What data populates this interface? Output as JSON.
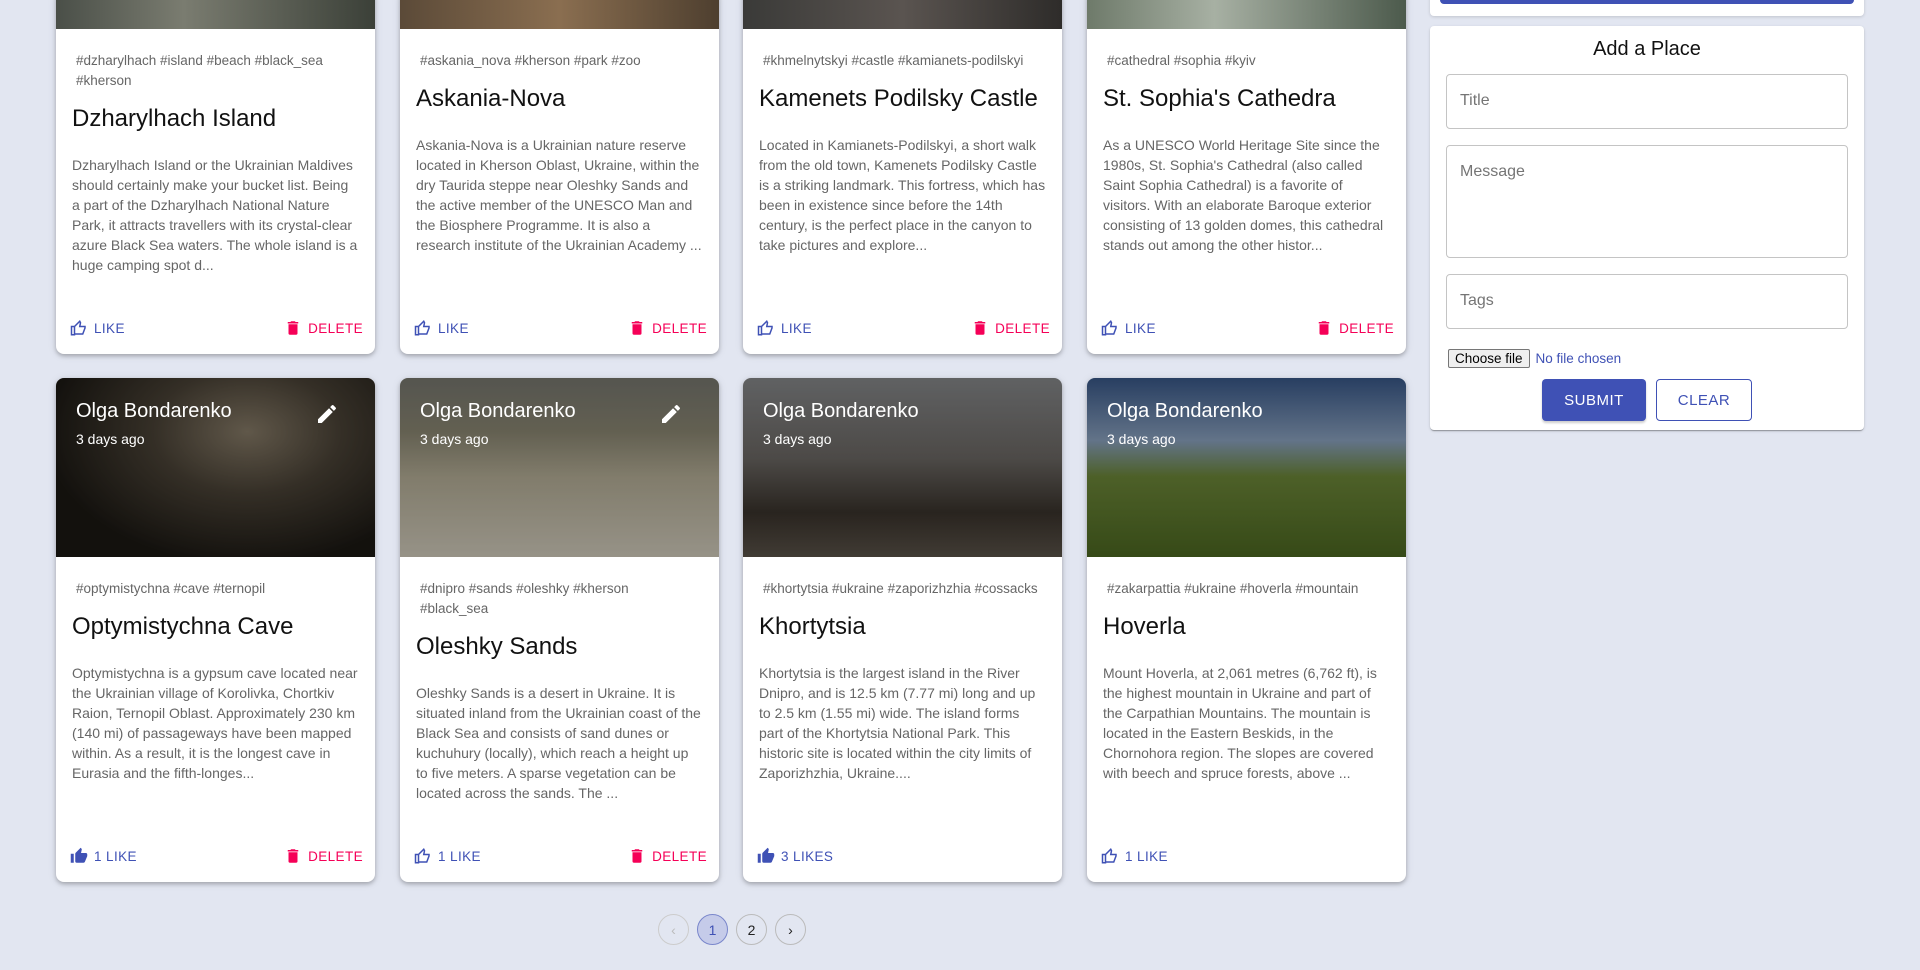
{
  "posts_row1": [
    {
      "tags": "#dzharylhach #island #beach #black_sea #kherson",
      "title": "Dzharylhach Island",
      "message": "Dzharylhach Island or the Ukrainian Maldives should certainly make your bucket list. Being a part of the Dzharylhach National Nature Park, it attracts travellers with its crystal-clear azure Black Sea waters. The whole island is a huge camping spot d...",
      "like_label": "LIKE",
      "delete_label": "DELETE"
    },
    {
      "tags": "#askania_nova #kherson #park #zoo",
      "title": "Askania-Nova",
      "message": "Askania-Nova is a Ukrainian nature reserve located in Kherson Oblast, Ukraine, within the dry Taurida steppe near Oleshky Sands and the active member of the UNESCO Man and the Biosphere Programme. It is also a research institute of the Ukrainian Academy ...",
      "like_label": "LIKE",
      "delete_label": "DELETE"
    },
    {
      "tags": "#khmelnytskyi #castle #kamianets-podilskyi",
      "title": "Kamenets Podilsky Castle",
      "message": "Located in Kamianets-Podilskyi, a short walk from the old town, Kamenets Podilsky Castle is a striking landmark. This fortress, which has been in existence since before the 14th century, is the perfect place in the canyon to take pictures and explore...",
      "like_label": "LIKE",
      "delete_label": "DELETE"
    },
    {
      "tags": "#cathedral #sophia #kyiv",
      "title": "St. Sophia's Cathedra",
      "message": "As a UNESCO World Heritage Site since the 1980s, St. Sophia's Cathedral (also called Saint Sophia Cathedral) is a favorite of visitors. With an elaborate Baroque exterior consisting of 13 golden domes, this cathedral stands out among the other histor...",
      "like_label": "LIKE",
      "delete_label": "DELETE"
    }
  ],
  "posts_row2": [
    {
      "author": "Olga Bondarenko",
      "time": "3 days ago",
      "tags": "#optymistychna #cave #ternopil",
      "title": "Optymistychna Cave",
      "message": "Optymistychna is a gypsum cave located near the Ukrainian village of Korolivka, Chortkiv Raion, Ternopil Oblast. Approximately 230 km (140 mi) of passageways have been mapped within. As a result, it is the longest cave in Eurasia and the fifth-longes...",
      "like_label": "1 LIKE",
      "delete_label": "DELETE"
    },
    {
      "author": "Olga Bondarenko",
      "time": "3 days ago",
      "tags": "#dnipro #sands #oleshky #kherson #black_sea",
      "title": "Oleshky Sands",
      "message": "Oleshky Sands is a desert in Ukraine. It is situated inland from the Ukrainian coast of the Black Sea and consists of sand dunes or kuchuhury (locally), which reach a height up to five meters. A sparse vegetation can be located across the sands. The ...",
      "like_label": "1 LIKE",
      "delete_label": "DELETE"
    },
    {
      "author": "Olga Bondarenko",
      "time": "3 days ago",
      "tags": "#khortytsia #ukraine #zaporizhzhia #cossacks",
      "title": "Khortytsia",
      "message": "Khortytsia is the largest island in the River Dnipro, and is 12.5 km (7.77 mi) long and up to 2.5 km (1.55 mi) wide. The island forms part of the Khortytsia National Park. This historic site is located within the city limits of Zaporizhzhia, Ukraine....",
      "like_label": "3 LIKES"
    },
    {
      "author": "Olga Bondarenko",
      "time": "3 days ago",
      "tags": "#zakarpattia #ukraine #hoverla #mountain",
      "title": "Hoverla",
      "message": "Mount Hoverla, at 2,061 metres (6,762 ft), is the highest mountain in Ukraine and part of the Carpathian Mountains. The mountain is located in the Eastern Beskids, in the Chornohora region. The slopes are covered with beech and spruce forests, above ...",
      "like_label": "1 LIKE"
    }
  ],
  "form": {
    "heading": "Add a Place",
    "title_placeholder": "Title",
    "message_placeholder": "Message",
    "tags_placeholder": "Tags",
    "file_button": "Choose file",
    "file_status": "No file chosen",
    "submit_label": "SUBMIT",
    "clear_label": "CLEAR"
  },
  "pagination": {
    "prev": "‹",
    "pages": [
      "1",
      "2"
    ],
    "next": "›",
    "active": "1"
  },
  "colors": {
    "primary": "#3f51b5",
    "danger": "#f50057",
    "background": "#e2e6f1"
  }
}
